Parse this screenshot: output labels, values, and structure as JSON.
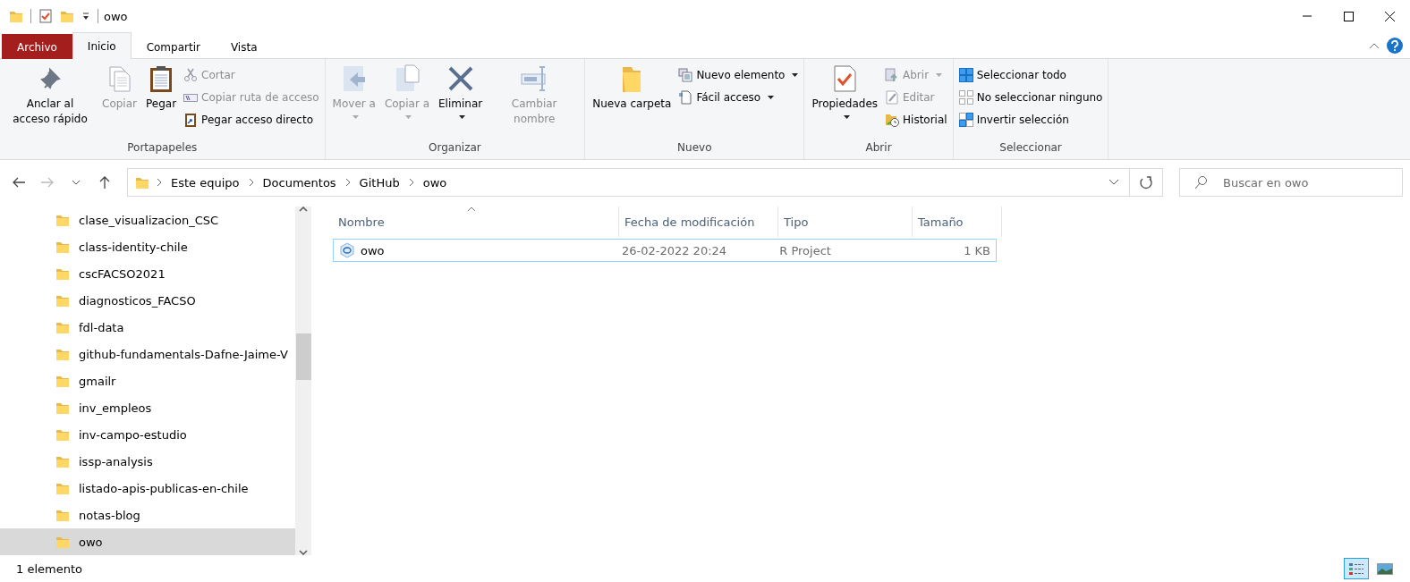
{
  "window": {
    "title": "owo"
  },
  "ribbon_tabs": [
    {
      "label": "Archivo",
      "kind": "file",
      "selected": false
    },
    {
      "label": "Inicio",
      "kind": "tab",
      "selected": true
    },
    {
      "label": "Compartir",
      "kind": "tab",
      "selected": false
    },
    {
      "label": "Vista",
      "kind": "tab",
      "selected": false
    }
  ],
  "ribbon_groups": [
    {
      "label": "Portapapeles",
      "items": [
        {
          "label": "Anclar al acceso rápido",
          "kind": "large",
          "disabled": false,
          "dropdown": false
        },
        {
          "label": "Copiar",
          "kind": "large",
          "disabled": true,
          "dropdown": false
        },
        {
          "label": "Pegar",
          "kind": "large",
          "disabled": false,
          "dropdown": false
        },
        {
          "label": "Cortar",
          "kind": "small",
          "disabled": true,
          "dropdown": false
        },
        {
          "label": "Copiar ruta de acceso",
          "kind": "small",
          "disabled": true,
          "dropdown": false
        },
        {
          "label": "Pegar acceso directo",
          "kind": "small",
          "disabled": false,
          "dropdown": false
        }
      ]
    },
    {
      "label": "Organizar",
      "items": [
        {
          "label": "Mover a",
          "kind": "large",
          "disabled": true,
          "dropdown": true
        },
        {
          "label": "Copiar a",
          "kind": "large",
          "disabled": true,
          "dropdown": true
        },
        {
          "label": "Eliminar",
          "kind": "large",
          "disabled": false,
          "dropdown": true
        },
        {
          "label": "Cambiar nombre",
          "kind": "large",
          "disabled": true,
          "dropdown": false
        }
      ]
    },
    {
      "label": "Nuevo",
      "items": [
        {
          "label": "Nueva carpeta",
          "kind": "large",
          "disabled": false,
          "dropdown": false
        },
        {
          "label": "Nuevo elemento",
          "kind": "small",
          "disabled": false,
          "dropdown": true
        },
        {
          "label": "Fácil acceso",
          "kind": "small",
          "disabled": false,
          "dropdown": true
        }
      ]
    },
    {
      "label": "Abrir",
      "items": [
        {
          "label": "Propiedades",
          "kind": "large",
          "disabled": false,
          "dropdown": true
        },
        {
          "label": "Abrir",
          "kind": "small",
          "disabled": true,
          "dropdown": true
        },
        {
          "label": "Editar",
          "kind": "small",
          "disabled": true,
          "dropdown": false
        },
        {
          "label": "Historial",
          "kind": "small",
          "disabled": false,
          "dropdown": false
        }
      ]
    },
    {
      "label": "Seleccionar",
      "items": [
        {
          "label": "Seleccionar todo",
          "kind": "small",
          "disabled": false,
          "dropdown": false
        },
        {
          "label": "No seleccionar ninguno",
          "kind": "small",
          "disabled": false,
          "dropdown": false
        },
        {
          "label": "Invertir selección",
          "kind": "small",
          "disabled": false,
          "dropdown": false
        }
      ]
    }
  ],
  "address_bar": {
    "segments": [
      "Este equipo",
      "Documentos",
      "GitHub",
      "owo"
    ]
  },
  "search": {
    "placeholder": "Buscar en owo"
  },
  "sidebar": {
    "items": [
      {
        "label": "clase_visualizacion_CSC",
        "selected": false
      },
      {
        "label": "class-identity-chile",
        "selected": false
      },
      {
        "label": "cscFACSO2021",
        "selected": false
      },
      {
        "label": "diagnosticos_FACSO",
        "selected": false
      },
      {
        "label": "fdl-data",
        "selected": false
      },
      {
        "label": "github-fundamentals-Dafne-Jaime-V",
        "selected": false
      },
      {
        "label": "gmailr",
        "selected": false
      },
      {
        "label": "inv_empleos",
        "selected": false
      },
      {
        "label": "inv-campo-estudio",
        "selected": false
      },
      {
        "label": "issp-analysis",
        "selected": false
      },
      {
        "label": "listado-apis-publicas-en-chile",
        "selected": false
      },
      {
        "label": "notas-blog",
        "selected": false
      },
      {
        "label": "owo",
        "selected": true
      }
    ]
  },
  "file_list": {
    "columns": [
      {
        "label": "Nombre",
        "sorted": true
      },
      {
        "label": "Fecha de modificación",
        "sorted": false
      },
      {
        "label": "Tipo",
        "sorted": false
      },
      {
        "label": "Tamaño",
        "sorted": false
      }
    ],
    "rows": [
      {
        "name": "owo",
        "date": "26-02-2022 20:24",
        "type": "R Project",
        "size": "1 KB",
        "focused": true
      }
    ]
  },
  "status_bar": {
    "text": "1 elemento",
    "views": [
      {
        "kind": "details",
        "selected": true
      },
      {
        "kind": "large-icons",
        "selected": false
      }
    ]
  }
}
